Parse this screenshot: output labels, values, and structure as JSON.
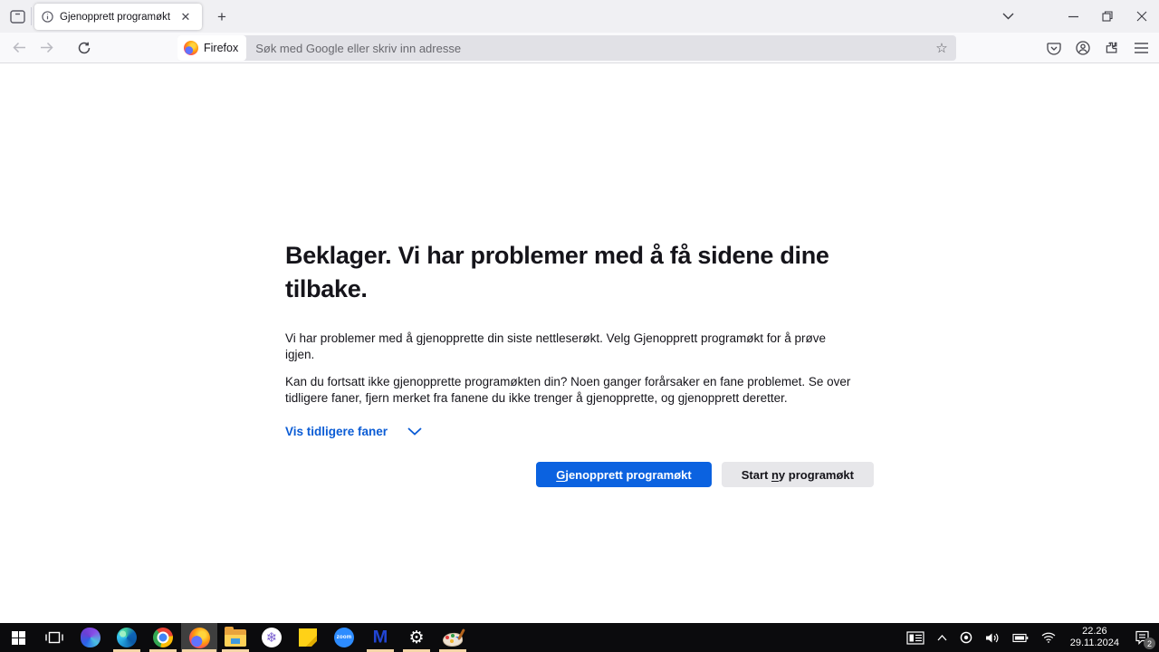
{
  "browser": {
    "tab_title": "Gjenopprett programøkt",
    "search_engine_chip": "Firefox",
    "url_placeholder": "Søk med Google eller skriv inn adresse"
  },
  "content": {
    "heading": "Beklager. Vi har problemer med å få sidene dine tilbake.",
    "paragraph1": "Vi har problemer med å gjenopprette din siste nettleserøkt. Velg Gjenopprett programøkt for å prøve igjen.",
    "paragraph2": "Kan du fortsatt ikke gjenopprette programøkten din? Noen ganger forårsaker en fane problemet. Se over tidligere faner, fjern merket fra fanene du ikke trenger å gjenopprette, og gjenopprett deretter.",
    "show_tabs_link": "Vis tidligere faner",
    "restore_button": {
      "accesskey": "G",
      "rest": "jenopprett programøkt"
    },
    "new_session_button": {
      "prefix": "Start ",
      "accesskey": "n",
      "rest": "y programøkt"
    }
  },
  "taskbar": {
    "apps": [
      "Start",
      "Task View",
      "Microsoft 365",
      "Microsoft Edge",
      "Google Chrome",
      "Firefox",
      "File Explorer",
      "Snowflake App",
      "Sticky Notes",
      "Zoom",
      "Malwarebytes",
      "Settings",
      "Paint 3D"
    ],
    "zoom_logo_text": "zoom",
    "malwarebytes_letter": "M",
    "gear_glyph": "⚙",
    "snowflake_glyph": "❄",
    "tray": {
      "time": "22.26",
      "date": "29.11.2024",
      "notification_count": "2"
    }
  },
  "colors": {
    "accent_blue": "#0b62e0",
    "link_blue": "#0b5cd5",
    "taskbar_underline": "#f6d6a8",
    "titlebar_bg": "#f0f0f3",
    "toolbar_bg": "#f9f9fb",
    "urlbar_bg": "#e1e1e6"
  }
}
